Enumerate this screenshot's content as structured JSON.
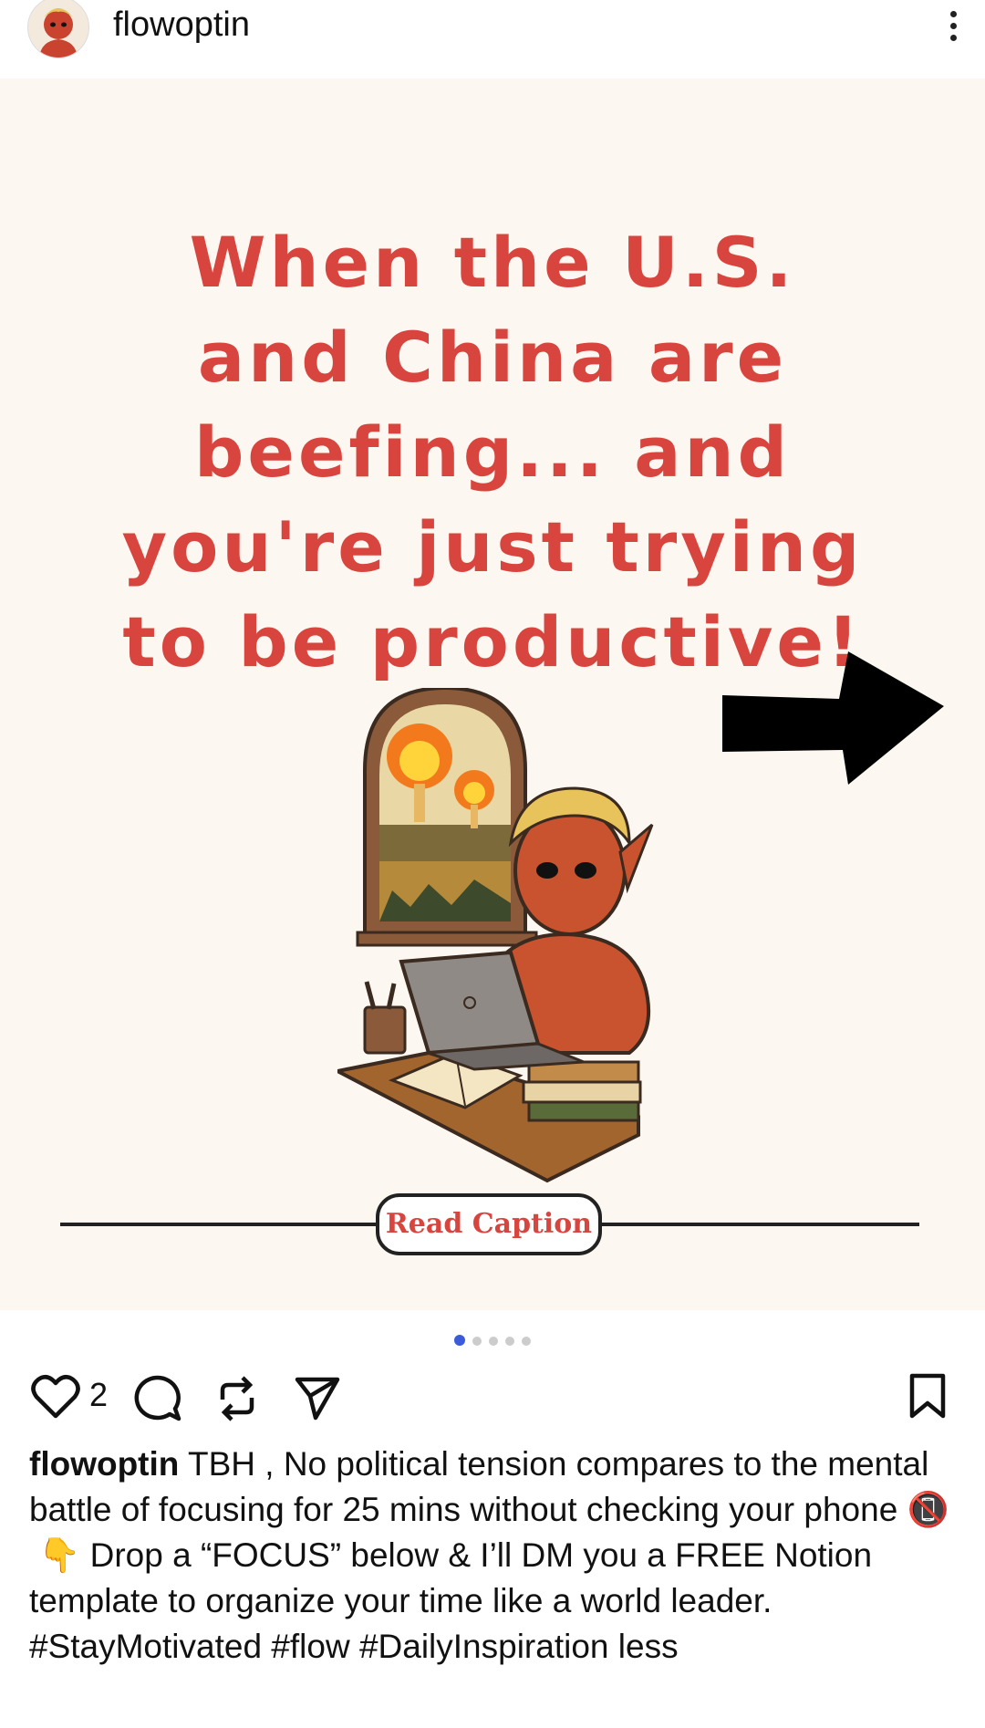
{
  "header": {
    "username": "flowoptin"
  },
  "post": {
    "headline_lines": [
      "When the U.S.",
      "and China are",
      "beefing... and",
      "you're just trying",
      "to be productive!"
    ],
    "button_label": "Read Caption",
    "carousel": {
      "total": 5,
      "active": 1
    }
  },
  "actions": {
    "like_count": "2"
  },
  "caption": {
    "username": "flowoptin",
    "line1": " TBH , No political tension compares to the mental battle of focusing for 25 mins without checking your phone ",
    "line1_emoji": "📵",
    "line2_emoji": "👇",
    "line2": " Drop a “FOCUS” below & I’ll DM you a FREE Notion template to organize your time like a world leader.",
    "line3": " #StayMotivated #flow #DailyInspiration ",
    "more": "less"
  },
  "colors": {
    "accent_red": "#d8453e",
    "post_bg": "#fdf7f1",
    "dot_active": "#3b5bdb"
  },
  "icons": [
    "more-vert-icon",
    "heart-icon",
    "comment-icon",
    "repost-icon",
    "send-icon",
    "bookmark-icon"
  ]
}
